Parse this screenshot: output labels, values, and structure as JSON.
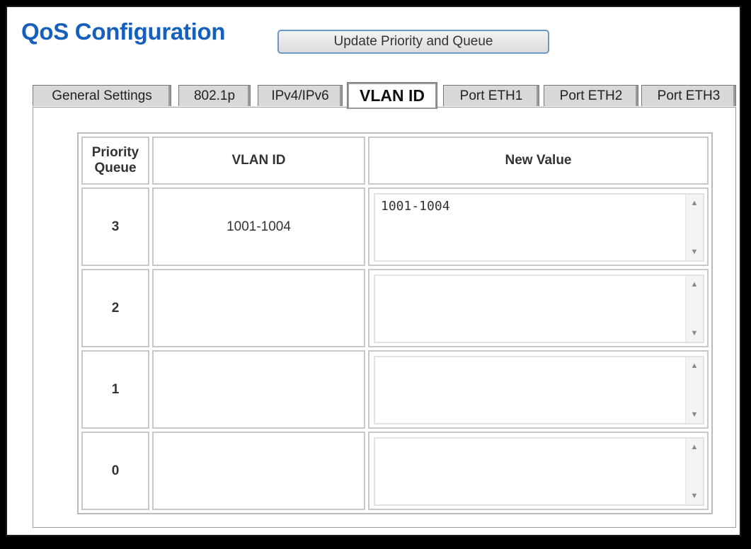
{
  "page": {
    "title": "QoS Configuration"
  },
  "toolbar": {
    "update_label": "Update Priority and Queue"
  },
  "tabs": [
    {
      "label": "General Settings"
    },
    {
      "label": "802.1p"
    },
    {
      "label": "IPv4/IPv6"
    },
    {
      "label": "VLAN ID",
      "active": true
    },
    {
      "label": "Port ETH1"
    },
    {
      "label": "Port ETH2"
    },
    {
      "label": "Port ETH3"
    }
  ],
  "table": {
    "headers": {
      "priority_line1": "Priority",
      "priority_line2": "Queue",
      "vlan_id": "VLAN ID",
      "new_value": "New Value"
    },
    "rows": [
      {
        "priority": "3",
        "vlan_id": "1001-1004",
        "new_value": "1001-1004"
      },
      {
        "priority": "2",
        "vlan_id": "",
        "new_value": ""
      },
      {
        "priority": "1",
        "vlan_id": "",
        "new_value": ""
      },
      {
        "priority": "0",
        "vlan_id": "",
        "new_value": ""
      }
    ]
  },
  "icons": {
    "scroll_up": "▲",
    "scroll_down": "▼"
  }
}
